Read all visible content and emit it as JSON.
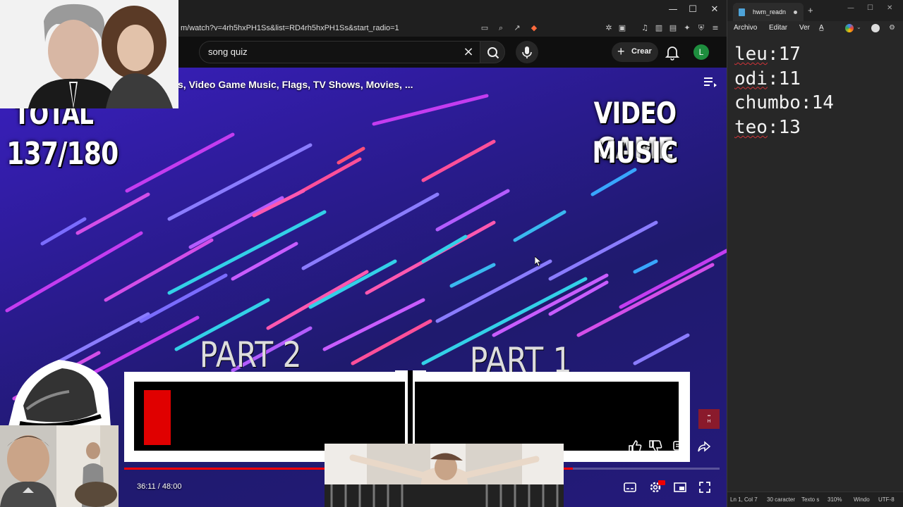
{
  "browser": {
    "url": "m/watch?v=4rh5hxPH1Ss&list=RD4rh5hxPH1Ss&start_radio=1",
    "window_controls": {
      "minimize": "—",
      "maximize": "☐",
      "close": "✕"
    }
  },
  "youtube": {
    "search_query": "song quiz",
    "create_label": "Crear",
    "avatar_letter": "L"
  },
  "video": {
    "playlist_title": "s, Video Game Music, Flags, TV Shows, Movies, ...",
    "total_label": "TOTAL",
    "total_score": "137/180",
    "category_line1": "VIDEO GAME",
    "category_line2": "MUSIC",
    "part2_label": "PART 2",
    "part1_label": "PART 1",
    "time_current": "36:11",
    "time_total": "48:00",
    "progress_fraction": 0.754
  },
  "notepad": {
    "tab_title": "hwm_readn",
    "menu": [
      "Archivo",
      "Editar",
      "Ver"
    ],
    "lines": [
      {
        "name": "leu",
        "score": "17"
      },
      {
        "name": "odi",
        "score": "11"
      },
      {
        "name": "chumbo",
        "score": "14"
      },
      {
        "name": "teo",
        "score": "13"
      }
    ],
    "status": {
      "position": "Ln 1, Col 7",
      "chars": "30 caracter",
      "format": "Texto s",
      "zoom": "310%",
      "line_ending": "Windo",
      "encoding": "UTF-8"
    }
  },
  "colors": {
    "accent_red": "#ff0000",
    "video_purple": "#2a1b8f",
    "avatar_green": "#1e8e3e",
    "notepad_bg": "#272727"
  }
}
